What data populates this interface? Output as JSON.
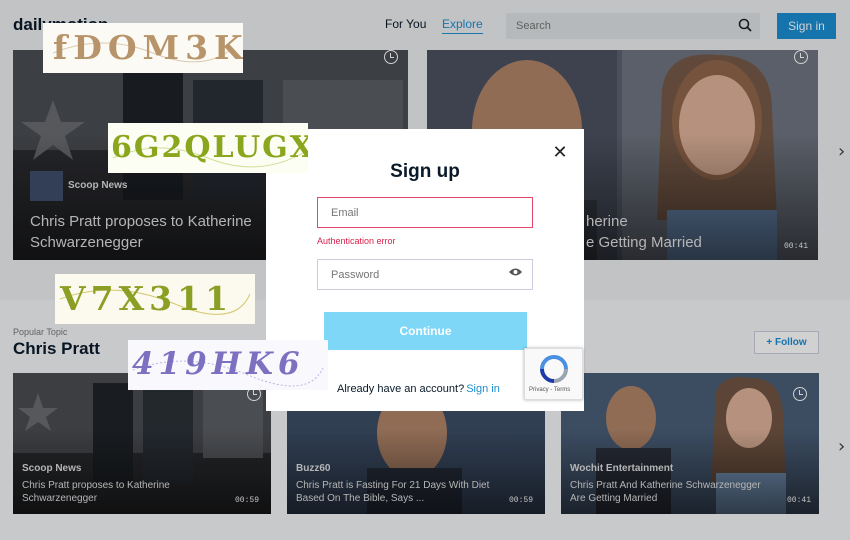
{
  "header": {
    "logo": "dailymotion",
    "nav": [
      {
        "label": "For You"
      },
      {
        "label": "Explore"
      }
    ],
    "search_placeholder": "Search",
    "signin_label": "Sign in"
  },
  "top_cards": [
    {
      "source": "Scoop News",
      "title_line1": "Chris Pratt proposes to Katherine",
      "title_line2": "Schwarzenegger"
    },
    {
      "title_line1": "herine",
      "title_line2": "e Getting Married",
      "duration": "00:41"
    }
  ],
  "topic": {
    "label": "Popular Topic",
    "title": "Chris Pratt",
    "follow_label": "Follow"
  },
  "cards": [
    {
      "source": "Scoop News",
      "title": "Chris Pratt proposes to Katherine Schwarzenegger",
      "duration": "00:59"
    },
    {
      "source": "Buzz60",
      "title": "Chris Pratt is Fasting For 21 Days With Diet Based On The Bible, Says ...",
      "duration": "00:59"
    },
    {
      "source": "Wochit Entertainment",
      "title": "Chris Pratt And Katherine Schwarzenegger Are Getting Married",
      "duration": "00:41"
    }
  ],
  "modal": {
    "title": "Sign up",
    "email_placeholder": "Email",
    "error_text": "Authentication error",
    "password_placeholder": "Password",
    "continue_label": "Continue",
    "already_text": "Already have an account?",
    "signin_link": "Sign in"
  },
  "recaptcha": {
    "privacy_terms": "Privacy - Terms"
  },
  "captchas": [
    {
      "text": "fDOM3K",
      "color": "#b8946a"
    },
    {
      "text": "6G2QLUGX",
      "color": "#8aa61c"
    },
    {
      "text": "V7X311",
      "color": "#8b9f24"
    },
    {
      "text": "419HK6",
      "color": "#7c70c0"
    }
  ],
  "colors": {
    "accent": "#1b8ed4",
    "error": "#d8214b",
    "continue": "#7fd7f7"
  }
}
